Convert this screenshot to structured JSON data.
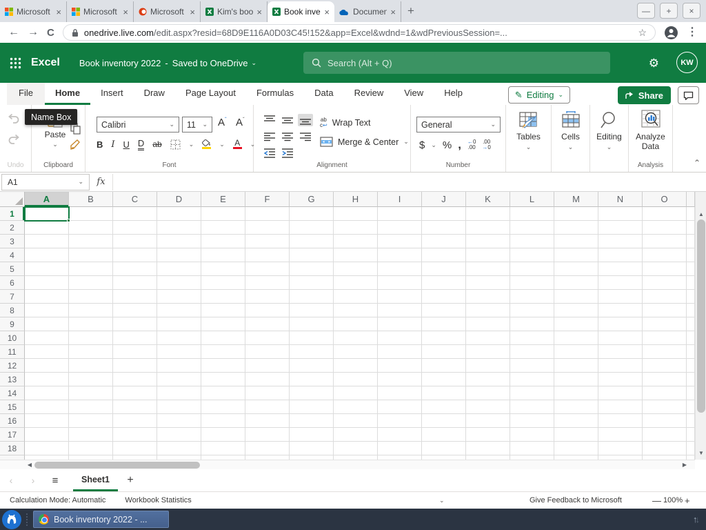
{
  "browser": {
    "tabs": [
      {
        "title": "Microsoft –",
        "icon": "microsoft-icon",
        "active": false
      },
      {
        "title": "Microsoft a",
        "icon": "microsoft-icon",
        "active": false
      },
      {
        "title": "Microsoft O",
        "icon": "office-icon",
        "active": false
      },
      {
        "title": "Kim's book",
        "icon": "excel-icon",
        "active": false
      },
      {
        "title": "Book inven",
        "icon": "excel-icon",
        "active": true
      },
      {
        "title": "Documents",
        "icon": "onedrive-icon",
        "active": false
      }
    ],
    "new_tab_label": "+",
    "window_controls": {
      "minimize": "—",
      "maximize": "+",
      "close": "×"
    },
    "url_domain": "onedrive.live.com",
    "url_path": "/edit.aspx?resid=68D9E116A0D03C45!152&app=Excel&wdnd=1&wdPreviousSession=..."
  },
  "header": {
    "app_name": "Excel",
    "doc_title": "Book inventory 2022",
    "dash": "-",
    "save_status": "Saved to OneDrive",
    "search_placeholder": "Search (Alt + Q)",
    "avatar_initials": "KW",
    "brand_green": "#107C41"
  },
  "ribbon": {
    "tabs": [
      {
        "label": "File",
        "active": false
      },
      {
        "label": "Home",
        "active": true
      },
      {
        "label": "Insert",
        "active": false
      },
      {
        "label": "Draw",
        "active": false
      },
      {
        "label": "Page Layout",
        "active": false
      },
      {
        "label": "Formulas",
        "active": false
      },
      {
        "label": "Data",
        "active": false
      },
      {
        "label": "Review",
        "active": false
      },
      {
        "label": "View",
        "active": false
      },
      {
        "label": "Help",
        "active": false
      }
    ],
    "mode_button": "Editing",
    "share_button": "Share",
    "tooltip": "Name Box",
    "groups": {
      "undo_label": "Undo",
      "clipboard": {
        "paste_label": "Paste",
        "label": "Clipboard"
      },
      "font": {
        "family": "Calibri",
        "size": "11",
        "label": "Font"
      },
      "alignment": {
        "wrap_label": "Wrap Text",
        "merge_label": "Merge & Center",
        "label": "Alignment"
      },
      "number": {
        "format": "General",
        "label": "Number"
      },
      "tables_label": "Tables",
      "cells_label": "Cells",
      "editing_label": "Editing",
      "analyze_label_1": "Analyze",
      "analyze_label_2": "Data",
      "analysis_label": "Analysis"
    }
  },
  "formula_bar": {
    "name_box": "A1",
    "fx_label": "fx",
    "formula_value": ""
  },
  "grid": {
    "columns": [
      "A",
      "B",
      "C",
      "D",
      "E",
      "F",
      "G",
      "H",
      "I",
      "J",
      "K",
      "L",
      "M",
      "N",
      "O"
    ],
    "row_count": 18,
    "selected_cell": "A1",
    "selected_column": "A",
    "selected_row": "1"
  },
  "sheet_bar": {
    "tabs": [
      {
        "label": "Sheet1",
        "active": true
      }
    ],
    "add_label": "+"
  },
  "status_bar": {
    "calculation_mode": "Calculation Mode: Automatic",
    "workbook_statistics": "Workbook Statistics",
    "feedback": "Give Feedback to Microsoft",
    "zoom_level": "100%"
  },
  "taskbar": {
    "window_button": "Book inventory 2022 - ..."
  }
}
